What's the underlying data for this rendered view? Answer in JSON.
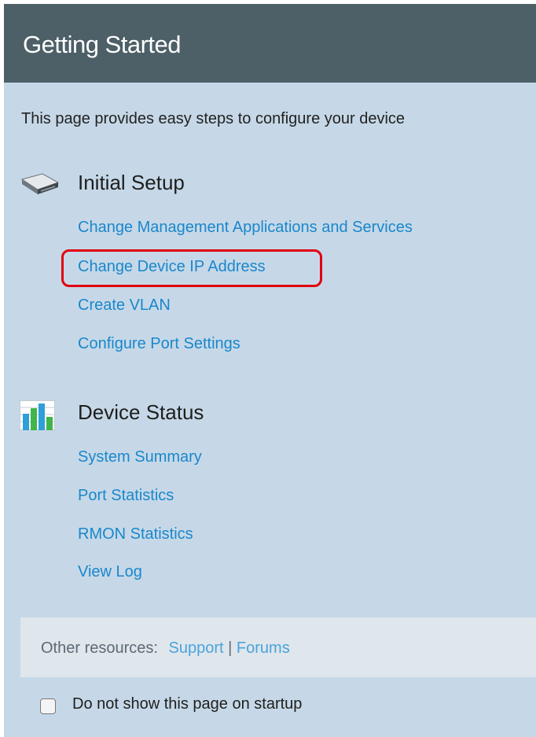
{
  "header": {
    "title": "Getting Started"
  },
  "intro": "This page provides easy steps to configure your device",
  "sections": [
    {
      "title": "Initial Setup",
      "icon": "switch-device-icon",
      "links": [
        "Change Management Applications and Services",
        "Change Device IP Address",
        "Create VLAN",
        "Configure Port Settings"
      ]
    },
    {
      "title": "Device Status",
      "icon": "bar-chart-icon",
      "links": [
        "System Summary",
        "Port Statistics",
        "RMON Statistics",
        "View Log"
      ]
    }
  ],
  "resources": {
    "label": "Other resources:",
    "support": "Support",
    "separator": "|",
    "forums": "Forums"
  },
  "startup_checkbox": {
    "label": "Do not show this page on startup",
    "checked": false
  },
  "colors": {
    "header_bg": "#4d5f67",
    "panel_bg": "#c6d8e7",
    "link": "#1a87cc",
    "highlight": "#e2000f"
  }
}
